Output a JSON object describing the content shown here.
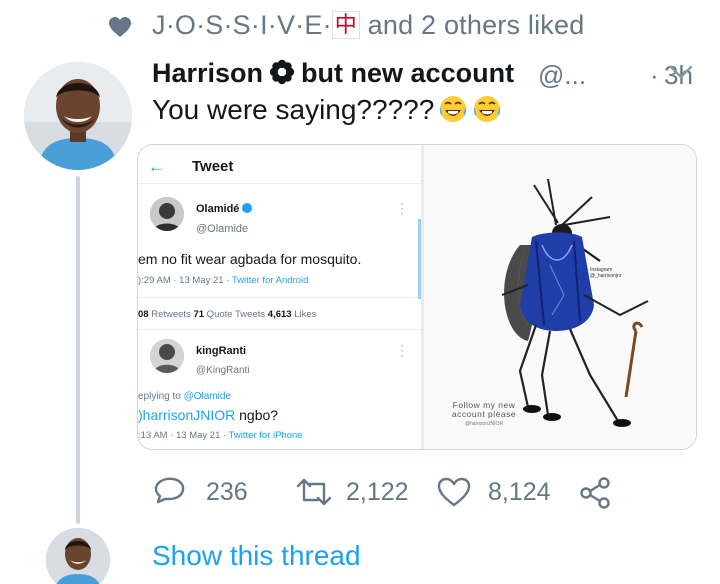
{
  "social_context": {
    "prefix": "J·O·S·S·I·V·E·",
    "emoji": "中",
    "suffix": " and 2 others liked"
  },
  "tweet": {
    "display_name_part1": "Harrison",
    "display_name_part2": "but new account",
    "handle": "@...",
    "dot": "·",
    "time": "3h",
    "text": "You were saying?????",
    "emoji_names": [
      "face-with-tears-of-joy-icon",
      "face-with-tears-of-joy-icon"
    ]
  },
  "screenshot": {
    "back_arrow": "←",
    "title": "Tweet",
    "quoted": {
      "name": "Olamidé",
      "handle": "@Olamide",
      "text": "em no fit wear agbada for mosquito.",
      "time": "):29 AM · 13 May 21 · ",
      "app": "Twitter for Android"
    },
    "stats": {
      "retweets_num": "08",
      "retweets_label": " Retweets  ",
      "quotes_num": "71",
      "quotes_label": " Quote Tweets  ",
      "likes_num": "4,613",
      "likes_label": " Likes"
    },
    "reply": {
      "name": "kingRanti",
      "handle": "@KingRanti",
      "replying_prefix": "eplying to ",
      "replying_to": "@Olamide",
      "mention": ")harrisonJNIOR",
      "text": " ngbo?",
      "time": ":13 AM · 13 May 21 · ",
      "app": "Twitter for iPhone"
    }
  },
  "picture": {
    "instagram_label": "Instagram",
    "instagram_handle": "@_harrisonjnr",
    "caption": "Follow my new account please",
    "caption_small": "@harrisonJNIOR"
  },
  "actions": {
    "reply_count": "236",
    "retweet_count": "2,122",
    "like_count": "8,124"
  },
  "show_thread": "Show this thread",
  "colors": {
    "accent": "#1da1f2",
    "secondary_text": "#657786",
    "thread_line": "#ccd6dd"
  }
}
